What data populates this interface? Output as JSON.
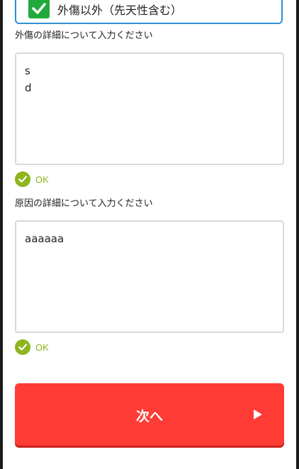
{
  "selected_option": {
    "label": "外傷以外（先天性含む）",
    "checked": true
  },
  "trauma_detail": {
    "label": "外傷の詳細について入力ください",
    "value": "s\nd",
    "status": "OK"
  },
  "cause_detail": {
    "label": "原因の詳細について入力ください",
    "value": "aaaaaa",
    "status": "OK"
  },
  "next_button": {
    "label": "次へ"
  },
  "colors": {
    "accent_border": "#2f8fd6",
    "checkbox_green": "#1faa3b",
    "ok_green": "#8db51d",
    "button_red": "#ff3b35"
  },
  "icons": {
    "checkbox": "check-icon",
    "status": "ok-check-circle-icon",
    "button_arrow": "play-triangle-icon"
  }
}
